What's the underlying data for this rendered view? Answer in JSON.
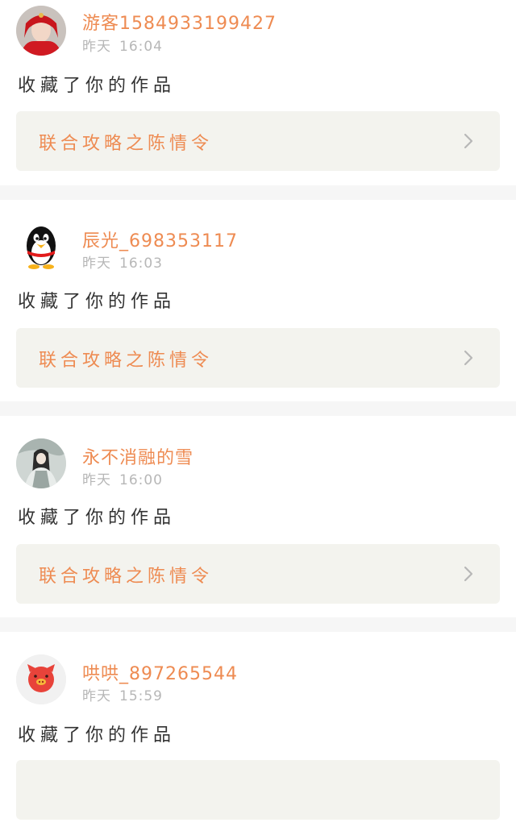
{
  "feed": [
    {
      "avatar": "avatar-red-headdress",
      "username": "游客1584933199427",
      "date": "昨天",
      "time": "16:04",
      "action": "收藏了你的作品",
      "work_title": "联合攻略之陈情令"
    },
    {
      "avatar": "avatar-qq-penguin",
      "username": "辰光_698353117",
      "date": "昨天",
      "time": "16:03",
      "action": "收藏了你的作品",
      "work_title": "联合攻略之陈情令"
    },
    {
      "avatar": "avatar-ink-painting",
      "username": "永不消融的雪",
      "date": "昨天",
      "time": "16:00",
      "action": "收藏了你的作品",
      "work_title": "联合攻略之陈情令"
    },
    {
      "avatar": "avatar-red-pig",
      "username": "哄哄_897265544",
      "date": "昨天",
      "time": "15:59",
      "action": "收藏了你的作品",
      "work_title": ""
    }
  ],
  "colors": {
    "accent": "#ee8b52",
    "secondary_text": "#b7b7b7",
    "card_bg": "#f3f3ee",
    "separator": "#f6f6f6"
  },
  "icons": {
    "chevron": "chevron-right-icon"
  }
}
